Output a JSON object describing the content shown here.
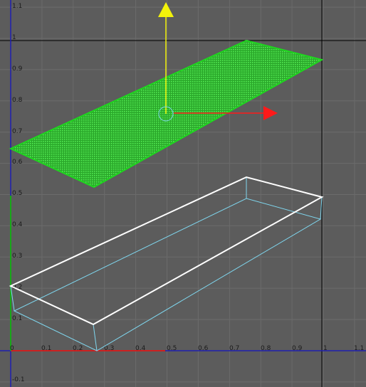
{
  "viewport": {
    "x_axis_labels": [
      "0",
      "0.1",
      "0.2",
      "0.3",
      "0.4",
      "0.5",
      "0.6",
      "0.7",
      "0.8",
      "0.9",
      "1",
      "1.1"
    ],
    "y_axis_labels": [
      "1.1",
      "1",
      "0.9",
      "0.8",
      "0.7",
      "0.6",
      "0.5",
      "0.4",
      "0.3",
      "0.2",
      "0.1",
      "-0.1"
    ]
  },
  "colors": {
    "background": "#5c5c5c",
    "grid_line": "#6b6b6b",
    "origin_x_axis": "#1f1fb0",
    "origin_y_axis": "#1f1fb0",
    "x_axis_highlight": "#cc2020",
    "y_axis_highlight": "#18a818",
    "selected_face": "#29e629",
    "selected_outline": "#1fd51f",
    "wire_top": "#ffffff",
    "wire_bottom": "#7fd6ee",
    "manip_y": "#f2f20a",
    "manip_x": "#ff1a1a",
    "manip_center": "#7fd6ee",
    "tick_text": "#1b1b1b",
    "frame_line": "#000000"
  },
  "manipulator": {
    "type": "translate-manipulator",
    "handles": [
      "y-axis-handle",
      "x-axis-handle",
      "center-handle"
    ]
  }
}
